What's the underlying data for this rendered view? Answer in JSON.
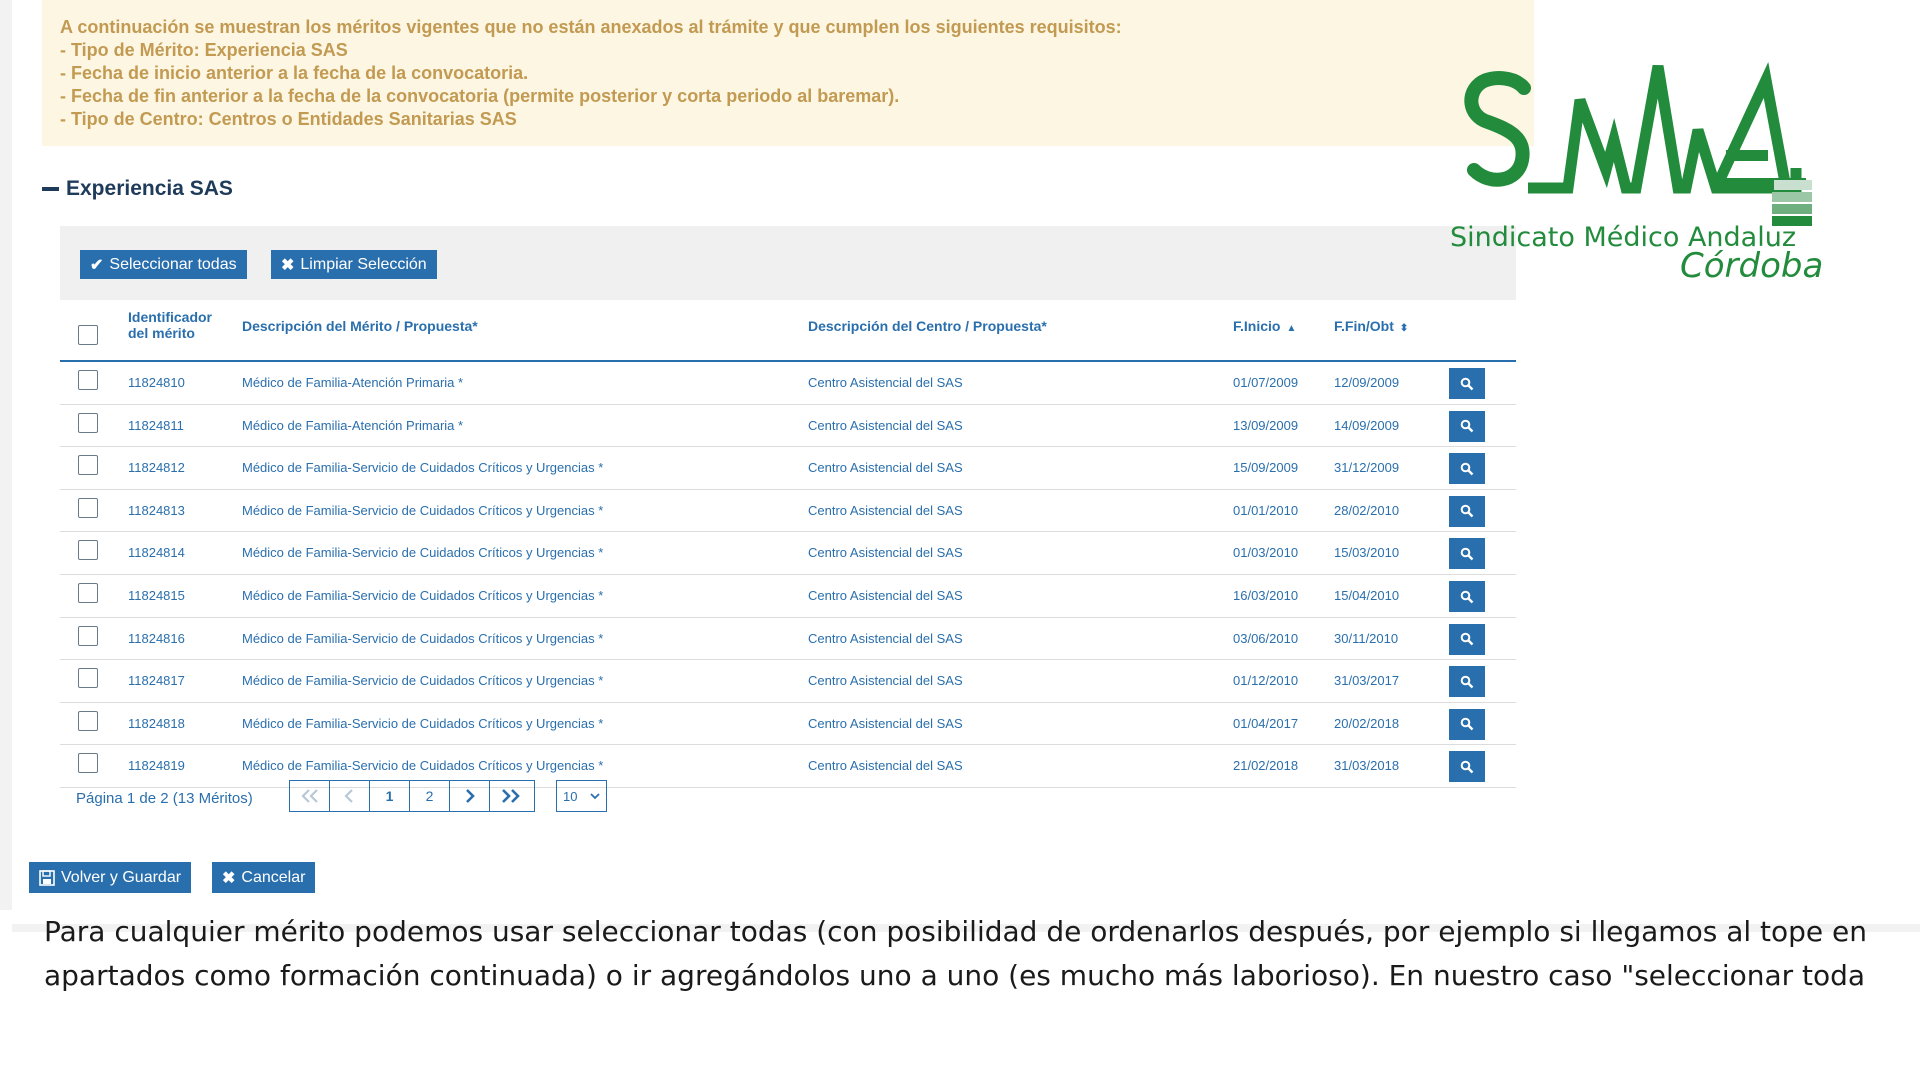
{
  "info": {
    "lines": [
      "A continuación se muestran los méritos vigentes que no están anexados al trámite y que cumplen los siguientes requisitos:",
      "- Tipo de Mérito: Experiencia SAS",
      "- Fecha de inicio anterior a la fecha de la convocatoria.",
      "- Fecha de fin anterior a la fecha de la convocatoria (permite posterior y corta periodo al baremar).",
      "- Tipo de Centro: Centros o Entidades Sanitarias SAS"
    ]
  },
  "section": {
    "title": "Experiencia SAS"
  },
  "toolbar": {
    "select_all": "Seleccionar todas",
    "clear": "Limpiar Selección"
  },
  "table": {
    "headers": {
      "id_line1": "Identificador",
      "id_line2": "del mérito",
      "desc": "Descripción del Mérito / Propuesta*",
      "center": "Descripción del Centro / Propuesta*",
      "start": "F.Inicio",
      "end": "F.Fin/Obt"
    },
    "rows": [
      {
        "id": "11824810",
        "desc": "Médico de Familia-Atención Primaria *",
        "center": "Centro Asistencial del SAS",
        "start": "01/07/2009",
        "end": "12/09/2009"
      },
      {
        "id": "11824811",
        "desc": "Médico de Familia-Atención Primaria *",
        "center": "Centro Asistencial del SAS",
        "start": "13/09/2009",
        "end": "14/09/2009"
      },
      {
        "id": "11824812",
        "desc": "Médico de Familia-Servicio de Cuidados Críticos y Urgencias *",
        "center": "Centro Asistencial del SAS",
        "start": "15/09/2009",
        "end": "31/12/2009"
      },
      {
        "id": "11824813",
        "desc": "Médico de Familia-Servicio de Cuidados Críticos y Urgencias *",
        "center": "Centro Asistencial del SAS",
        "start": "01/01/2010",
        "end": "28/02/2010"
      },
      {
        "id": "11824814",
        "desc": "Médico de Familia-Servicio de Cuidados Críticos y Urgencias *",
        "center": "Centro Asistencial del SAS",
        "start": "01/03/2010",
        "end": "15/03/2010"
      },
      {
        "id": "11824815",
        "desc": "Médico de Familia-Servicio de Cuidados Críticos y Urgencias *",
        "center": "Centro Asistencial del SAS",
        "start": "16/03/2010",
        "end": "15/04/2010"
      },
      {
        "id": "11824816",
        "desc": "Médico de Familia-Servicio de Cuidados Críticos y Urgencias *",
        "center": "Centro Asistencial del SAS",
        "start": "03/06/2010",
        "end": "30/11/2010"
      },
      {
        "id": "11824817",
        "desc": "Médico de Familia-Servicio de Cuidados Críticos y Urgencias *",
        "center": "Centro Asistencial del SAS",
        "start": "01/12/2010",
        "end": "31/03/2017"
      },
      {
        "id": "11824818",
        "desc": "Médico de Familia-Servicio de Cuidados Críticos y Urgencias *",
        "center": "Centro Asistencial del SAS",
        "start": "01/04/2017",
        "end": "20/02/2018"
      },
      {
        "id": "11824819",
        "desc": "Médico de Familia-Servicio de Cuidados Críticos y Urgencias *",
        "center": "Centro Asistencial del SAS",
        "start": "21/02/2018",
        "end": "31/03/2018"
      }
    ]
  },
  "pagination": {
    "info": "Página 1 de 2 (13 Méritos)",
    "page1": "1",
    "page2": "2",
    "page_size": "10"
  },
  "actions": {
    "save": "Volver y Guardar",
    "cancel": "Cancelar"
  },
  "logo": {
    "sub1": "Sindicato Médico Andaluz",
    "sub2": "Córdoba",
    "color": "#228b3c"
  },
  "caption": {
    "line1": "Para cualquier mérito podemos usar seleccionar todas (con posibilidad de ordenarlos después, por ejemplo si llegamos al tope en",
    "line2": "apartados como formación continuada) o ir agregándolos uno a uno (es mucho más laborioso). En nuestro caso \"seleccionar toda"
  },
  "colors": {
    "primary": "#2a6fad",
    "notice_bg": "#fcf6e3",
    "notice_text": "#c29a52"
  }
}
